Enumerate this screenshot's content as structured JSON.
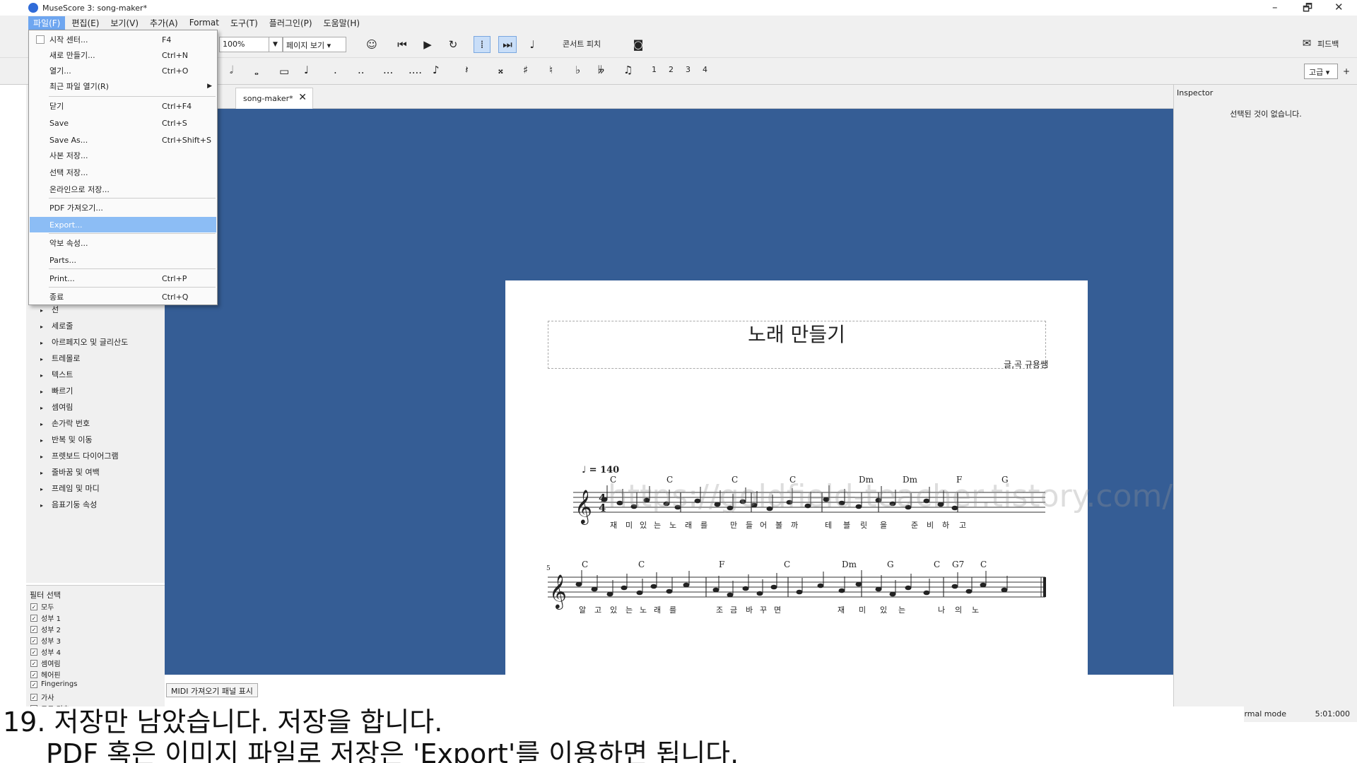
{
  "window": {
    "title": "MuseScore 3: song-maker*",
    "minimize": "–",
    "restore": "🗗",
    "close": "✕"
  },
  "menubar": {
    "items": [
      "파일(F)",
      "편집(E)",
      "보기(V)",
      "추가(A)",
      "Format",
      "도구(T)",
      "플러그인(P)",
      "도움말(H)"
    ]
  },
  "toolbar": {
    "zoom": "100%",
    "view_mode": "페이지 보기",
    "concert_pitch": "콘서트 피치",
    "feedback": "피드백",
    "advanced": "고급",
    "voices": [
      "1",
      "2",
      "3",
      "4"
    ]
  },
  "file_menu": {
    "items": [
      {
        "label": "시작 센터...",
        "shortcut": "F4"
      },
      {
        "label": "새로 만들기...",
        "shortcut": "Ctrl+N"
      },
      {
        "label": "열기...",
        "shortcut": "Ctrl+O"
      },
      {
        "label": "최근 파일 열기(R)",
        "shortcut": ""
      },
      {
        "label": "닫기",
        "shortcut": "Ctrl+F4"
      },
      {
        "label": "Save",
        "shortcut": "Ctrl+S"
      },
      {
        "label": "Save As...",
        "shortcut": "Ctrl+Shift+S"
      },
      {
        "label": "사본 저장...",
        "shortcut": ""
      },
      {
        "label": "선택 저장...",
        "shortcut": ""
      },
      {
        "label": "온라인으로 저장...",
        "shortcut": ""
      },
      {
        "label": "PDF 가져오기...",
        "shortcut": ""
      },
      {
        "label": "Export...",
        "shortcut": ""
      },
      {
        "label": "악보 속성...",
        "shortcut": ""
      },
      {
        "label": "Parts...",
        "shortcut": ""
      },
      {
        "label": "Print...",
        "shortcut": "Ctrl+P"
      },
      {
        "label": "종료",
        "shortcut": "Ctrl+Q"
      }
    ]
  },
  "tab": {
    "label": "song-maker*"
  },
  "palettes": {
    "items": [
      "선",
      "세로줄",
      "아르페지오 및 글리산도",
      "트레몰로",
      "텍스트",
      "빠르기",
      "셈여림",
      "손가락 번호",
      "반복 및 이동",
      "프렛보드 다이어그램",
      "줄바꿈 및 여백",
      "프레임 및 마디",
      "음표기둥 속성"
    ]
  },
  "filter": {
    "title": "필터 선택",
    "items": [
      "모두",
      "성부 1",
      "성부 2",
      "성부 3",
      "성부 4",
      "셈여림",
      "헤어핀",
      "Fingerings",
      "가사",
      "코드 기호"
    ]
  },
  "score": {
    "title": "노래 만들기",
    "composer": "글,곡 규용쌤",
    "tempo": "= 140",
    "measure_number": "5",
    "watermark": "https://goldfield-teacher.tistory.com/",
    "chords_row1": [
      "C",
      "C",
      "C",
      "C",
      "Dm",
      "Dm",
      "F",
      "G"
    ],
    "chords_row2": [
      "C",
      "C",
      "F",
      "C",
      "Dm",
      "G",
      "C",
      "G7",
      "C"
    ],
    "lyrics_row1": [
      "재",
      "미",
      "있",
      "는",
      "노",
      "래",
      "를",
      "만",
      "들",
      "어",
      "볼",
      "까",
      "테",
      "블",
      "릿",
      "을",
      "준",
      "비",
      "하",
      "고"
    ],
    "lyrics_row2": [
      "알",
      "고",
      "있",
      "는",
      "노",
      "래",
      "를",
      "조",
      "금",
      "바",
      "꾸",
      "면",
      "재",
      "미",
      "있",
      "는",
      "나",
      "의",
      "노"
    ]
  },
  "inspector": {
    "title": "Inspector",
    "empty": "선택된 것이 없습니다."
  },
  "midi_button": "MIDI 가져오기 패널 표시",
  "status": {
    "mode": "Normal mode",
    "time": "5:01:000"
  },
  "caption": {
    "line1": "19. 저장만 남았습니다. 저장을 합니다.",
    "line2": "PDF 혹은 이미지 파일로 저장은 'Export'를 이용하면 됩니다."
  }
}
